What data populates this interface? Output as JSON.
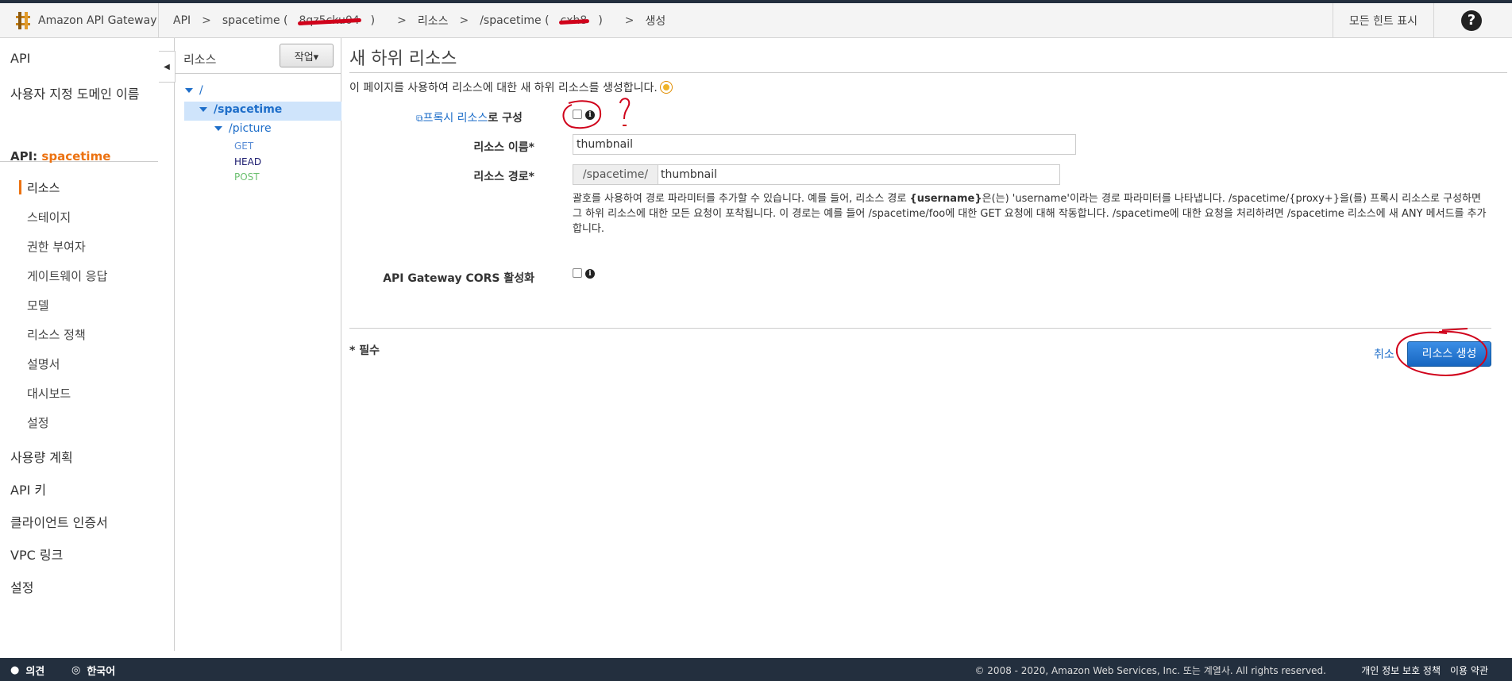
{
  "topbar": {
    "brand": "Amazon API Gateway",
    "crumbs": [
      "API",
      ">",
      "spacetime (",
      "8qz5cku04",
      ")",
      ">",
      "리소스",
      ">",
      "/spacetime (",
      "cxh8",
      ")",
      ">",
      "생성"
    ],
    "hints": "모든 힌트 표시",
    "help": "?"
  },
  "sidenav": {
    "api": "API",
    "custom_domain": "사용자 지정 도메인 이름",
    "api_prefix": "API: ",
    "api_name": "spacetime",
    "items": [
      "리소스",
      "스테이지",
      "권한 부여자",
      "게이트웨이 응답",
      "모델",
      "리소스 정책",
      "설명서",
      "대시보드",
      "설정"
    ],
    "bottom": [
      "사용량 계획",
      "API 키",
      "클라이언트 인증서",
      "VPC 링크",
      "설정"
    ]
  },
  "tree": {
    "header": "리소스",
    "actions": "작업▾",
    "root": "/",
    "spacetime": "/spacetime",
    "picture": "/picture",
    "methods": [
      "GET",
      "HEAD",
      "POST"
    ],
    "method_colors": [
      "#1e6ec9",
      "#1a1a6e",
      "#6cc070"
    ]
  },
  "main": {
    "title": "새 하위 리소스",
    "intro": "이 페이지를 사용하여 리소스에 대한 새 하위 리소스를 생성합니다.",
    "proxy_link": "프록시 리소스",
    "proxy_suffix": "로 구성",
    "name_label": "리소스 이름*",
    "name_value": "thumbnail",
    "path_label": "리소스 경로*",
    "path_prefix": "/spacetime/",
    "path_value": "thumbnail",
    "help_1": "괄호를 사용하여 경로 파라미터를 추가할 수 있습니다. 예를 들어, 리소스 경로 ",
    "help_bold": "{username}",
    "help_2": "은(는) 'username'이라는 경로 파라미터를 나타냅니다. /spacetime/{proxy+}을(를) 프록시 리소스로 구성하면 그 하위 리소스에 대한 모든 요청이 포착됩니다. 이 경로는 예를 들어 /spacetime/foo에 대한 GET 요청에 대해 작동합니다. /spacetime에 대한 요청을 처리하려면 /spacetime 리소스에 새 ANY 메서드를 추가합니다.",
    "cors_label": "API Gateway CORS 활성화",
    "required": "* 필수",
    "cancel": "취소",
    "create": "리소스 생성"
  },
  "footer": {
    "feedback": "의견",
    "language": "한국어",
    "copyright": "© 2008 - 2020, Amazon Web Services, Inc. 또는 계열사. All rights reserved.",
    "privacy": "개인 정보 보호 정책",
    "terms": "이용 약관"
  },
  "colors": {
    "accent": "#ec7211",
    "link": "#1e6ec9",
    "primary": "#1766c0",
    "annotation": "#d0021b"
  }
}
